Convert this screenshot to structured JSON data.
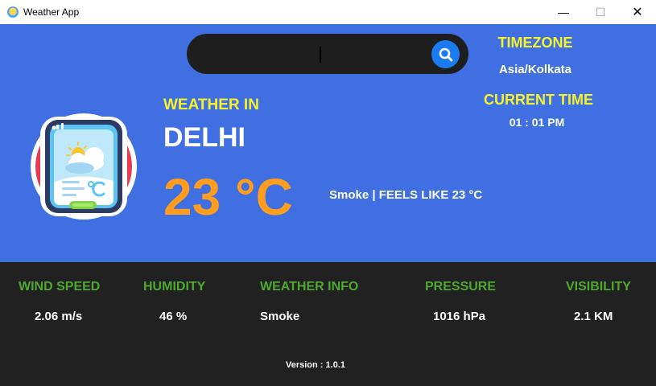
{
  "window": {
    "title": "Weather App",
    "minimize_glyph": "—",
    "maximize_glyph": "☐",
    "close_glyph": "✕"
  },
  "search": {
    "value": "",
    "icon": "search-icon"
  },
  "timezone": {
    "label": "TIMEZONE",
    "value": "Asia/Kolkata"
  },
  "current_time": {
    "label": "CURRENT TIME",
    "value": "01 : 01 PM"
  },
  "weather": {
    "heading": "WEATHER IN",
    "city": "DELHI",
    "temperature": "23 °C",
    "condition_line": "Smoke | FEELS LIKE 23 °C",
    "logo_icon": "weather-app-logo-icon"
  },
  "stats": [
    {
      "label": "WIND SPEED",
      "value": "2.06 m/s"
    },
    {
      "label": "HUMIDITY",
      "value": "46 %"
    },
    {
      "label": "WEATHER INFO",
      "value": "Smoke"
    },
    {
      "label": "PRESSURE",
      "value": "1016 hPa"
    },
    {
      "label": "VISIBILITY",
      "value": "2.1 KM"
    }
  ],
  "version": "Version : 1.0.1",
  "colors": {
    "top_panel": "#3f6fe0",
    "bottom_panel": "#212121",
    "accent_yellow": "#f6f32b",
    "temperature_orange": "#ff9d1f",
    "stat_label_green": "#4fa82f",
    "search_button": "#1a7cf0"
  }
}
